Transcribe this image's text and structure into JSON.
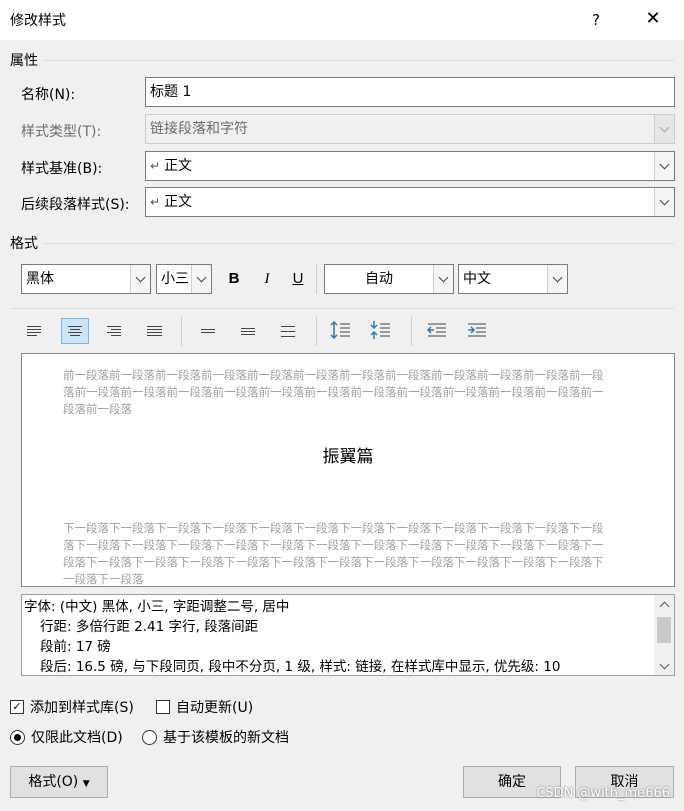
{
  "window": {
    "title": "修改样式",
    "help": "?",
    "close": "✕"
  },
  "properties": {
    "group_label": "属性",
    "name_label": "名称(N):",
    "name_value": "标题 1",
    "type_label": "样式类型(T):",
    "type_value": "链接段落和字符",
    "based_on_label": "样式基准(B):",
    "based_on_value": "正文",
    "next_label": "后续段落样式(S):",
    "next_value": "正文"
  },
  "format": {
    "group_label": "格式",
    "font": "黑体",
    "size": "小三",
    "bold": "B",
    "italic": "I",
    "underline": "U",
    "color": "自动",
    "script": "中文"
  },
  "preview": {
    "prev_para": "前一段落前一段落前一段落前一段落前一段落前一段落前一段落前一段落前一段落前一段落前一段落前一段落前一段落前一段落前一段落前一段落前一段落前一段落前一段落前一段落前一段落前一段落前一段落前一段落前一段落",
    "sample": "振翼篇",
    "next_para": "下一段落下一段落下一段落下一段落下一段落下一段落下一段落下一段落下一段落下一段落下一段落下一段落下一段落下一段落下一段落下一段落下一段落下一段落下一段落下一段落下一段落下一段落下一段落下一段落下一段落下一段落下一段落下一段落下一段落下一段落下一段落下一段落下一段落下一段落下一段落下一段落下一段落"
  },
  "description": {
    "line1": "字体: (中文) 黑体, 小三, 字距调整二号, 居中",
    "line2": "行距: 多倍行距 2.41 字行, 段落间距",
    "line3": "段前: 17 磅",
    "line4": "段后: 16.5 磅, 与下段同页, 段中不分页, 1 级, 样式: 链接, 在样式库中显示, 优先级: 10"
  },
  "options": {
    "add_to_gallery": "添加到样式库(S)",
    "add_to_gallery_checked": true,
    "auto_update": "自动更新(U)",
    "auto_update_checked": false,
    "only_this_doc": "仅限此文档(D)",
    "new_docs": "基于该模板的新文档"
  },
  "buttons": {
    "format": "格式(O)",
    "ok": "确定",
    "cancel": "取消"
  },
  "watermark": "CSDN @with_me666",
  "colors": {
    "active_align_bg": "#cce4f7",
    "preview_gray": "#a0a0a0"
  }
}
